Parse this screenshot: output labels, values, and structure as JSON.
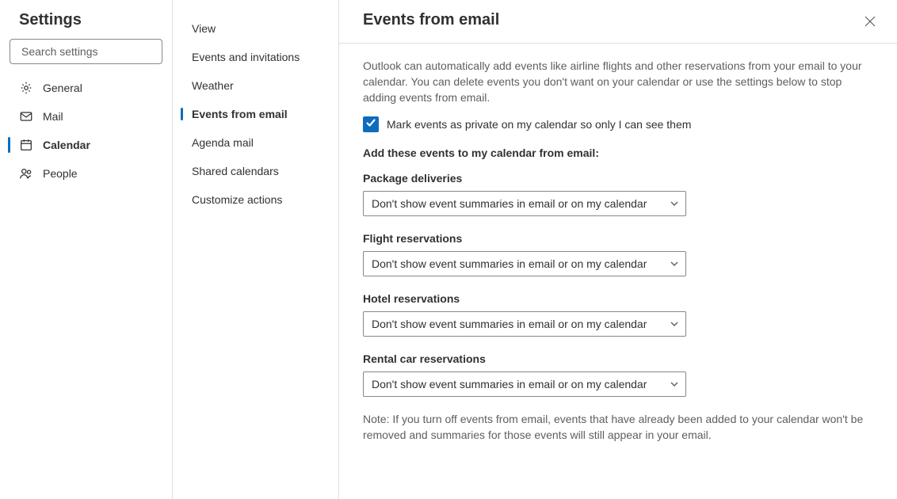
{
  "settings_title": "Settings",
  "search_placeholder": "Search settings",
  "nav": {
    "general": "General",
    "mail": "Mail",
    "calendar": "Calendar",
    "people": "People"
  },
  "subnav": {
    "view": "View",
    "events_invitations": "Events and invitations",
    "weather": "Weather",
    "events_from_email": "Events from email",
    "agenda_mail": "Agenda mail",
    "shared_calendars": "Shared calendars",
    "customize_actions": "Customize actions"
  },
  "page": {
    "title": "Events from email",
    "description": "Outlook can automatically add events like airline flights and other reservations from your email to your calendar. You can delete events you don't want on your calendar or use the settings below to stop adding events from email.",
    "checkbox_label": "Mark events as private on my calendar so only I can see them",
    "checkbox_checked": true,
    "add_label": "Add these events to my calendar from email:",
    "fields": {
      "package_label": "Package deliveries",
      "package_value": "Don't show event summaries in email or on my calendar",
      "flight_label": "Flight reservations",
      "flight_value": "Don't show event summaries in email or on my calendar",
      "hotel_label": "Hotel reservations",
      "hotel_value": "Don't show event summaries in email or on my calendar",
      "rental_label": "Rental car reservations",
      "rental_value": "Don't show event summaries in email or on my calendar"
    },
    "note": "Note: If you turn off events from email, events that have already been added to your calendar won't be removed and summaries for those events will still appear in your email."
  }
}
